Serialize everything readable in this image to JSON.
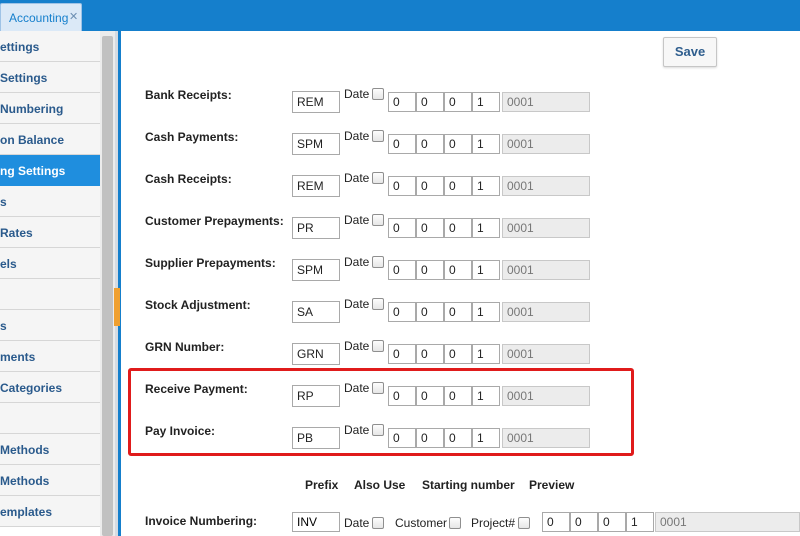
{
  "tab": {
    "label": "Accounting",
    "close": "✕"
  },
  "sidebar": {
    "items": [
      {
        "label": "ettings",
        "active": false
      },
      {
        "label": " Settings",
        "active": false
      },
      {
        "label": " Numbering",
        "active": false
      },
      {
        "label": "on Balance",
        "active": false
      },
      {
        "label": "ng Settings",
        "active": true
      },
      {
        "label": "s",
        "active": false
      },
      {
        "label": " Rates",
        "active": false
      },
      {
        "label": "els",
        "active": false
      },
      {
        "label": "",
        "active": false
      },
      {
        "label": "s",
        "active": false
      },
      {
        "label": "ments",
        "active": false
      },
      {
        "label": "Categories",
        "active": false
      },
      {
        "label": "",
        "active": false
      },
      {
        "label": " Methods",
        "active": false
      },
      {
        "label": "Methods",
        "active": false
      },
      {
        "label": "emplates",
        "active": false
      }
    ]
  },
  "toolbar": {
    "save_label": "Save"
  },
  "form": {
    "date_label": "Date",
    "rows": [
      {
        "label": "Bank Receipts:",
        "prefix": "REM",
        "digits": [
          "0",
          "0",
          "0",
          "1"
        ],
        "preview": "0001"
      },
      {
        "label": "Cash Payments:",
        "prefix": "SPM",
        "digits": [
          "0",
          "0",
          "0",
          "1"
        ],
        "preview": "0001"
      },
      {
        "label": "Cash Receipts:",
        "prefix": "REM",
        "digits": [
          "0",
          "0",
          "0",
          "1"
        ],
        "preview": "0001"
      },
      {
        "label": "Customer Prepayments:",
        "prefix": "PR",
        "digits": [
          "0",
          "0",
          "0",
          "1"
        ],
        "preview": "0001"
      },
      {
        "label": "Supplier Prepayments:",
        "prefix": "SPM",
        "digits": [
          "0",
          "0",
          "0",
          "1"
        ],
        "preview": "0001"
      },
      {
        "label": "Stock Adjustment:",
        "prefix": "SA",
        "digits": [
          "0",
          "0",
          "0",
          "1"
        ],
        "preview": "0001"
      },
      {
        "label": "GRN Number:",
        "prefix": "GRN",
        "digits": [
          "0",
          "0",
          "0",
          "1"
        ],
        "preview": "0001"
      },
      {
        "label": "Receive Payment:",
        "prefix": "RP",
        "digits": [
          "0",
          "0",
          "0",
          "1"
        ],
        "preview": "0001"
      },
      {
        "label": "Pay Invoice:",
        "prefix": "PB",
        "digits": [
          "0",
          "0",
          "0",
          "1"
        ],
        "preview": "0001"
      }
    ]
  },
  "invoice": {
    "headers": {
      "prefix": "Prefix",
      "also_use": "Also Use",
      "starting_number": "Starting number",
      "preview": "Preview"
    },
    "label": "Invoice Numbering:",
    "prefix": "INV",
    "date_label": "Date",
    "customer_label": "Customer",
    "project_label": "Project#",
    "digits": [
      "0",
      "0",
      "0",
      "1"
    ],
    "preview": "0001"
  },
  "colors": {
    "accent": "#157fcc",
    "active_item": "#1f8ede",
    "highlight": "#e01b1b"
  }
}
